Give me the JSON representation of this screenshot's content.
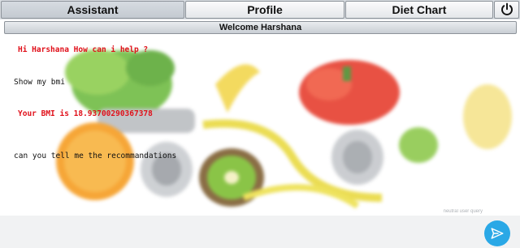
{
  "tabs": [
    {
      "label": "Assistant",
      "active": true
    },
    {
      "label": "Profile",
      "active": false
    },
    {
      "label": "Diet Chart",
      "active": false
    }
  ],
  "power_icon": "power-icon",
  "welcome": "Welcome Harshana",
  "messages": [
    {
      "sender": "bot",
      "text": "Hi Harshana How can i help ?"
    },
    {
      "sender": "user",
      "text": "Show my bmi"
    },
    {
      "sender": "bot",
      "text": "Your BMI is 18.93700290367378"
    },
    {
      "sender": "user",
      "text": "can you tell me the recommandations"
    }
  ],
  "input": {
    "placeholder": "neutral user query",
    "value": ""
  },
  "send_icon": "send-icon",
  "colors": {
    "bot_text": "#e0101a",
    "user_text": "#111111",
    "send_button": "#2aa8e6"
  }
}
